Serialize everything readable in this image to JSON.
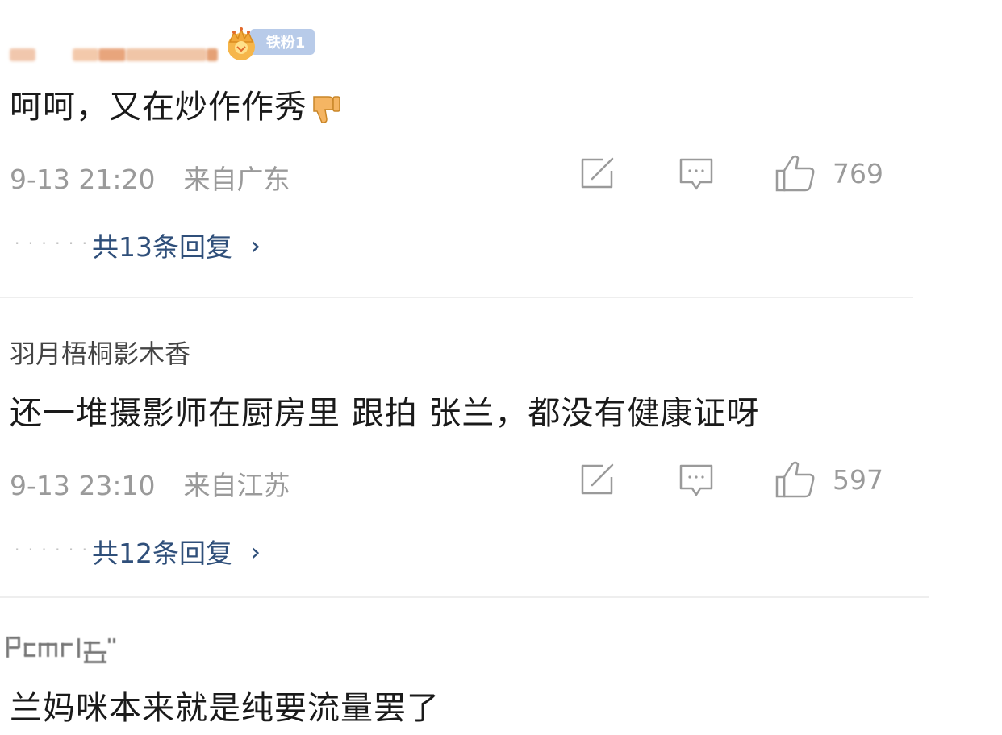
{
  "comments": [
    {
      "username": "",
      "badge": "铁粉1",
      "content": "呵呵，又在炒作作秀",
      "content_emoji": "thumbs-down-icon",
      "time": "9-13 21:20",
      "location": "来自广东",
      "likes": "769",
      "replies": "共13条回复"
    },
    {
      "username": "羽月梧桐影木香",
      "content": "还一堆摄影师在厨房里 跟拍 张兰，都没有健康证呀",
      "time": "9-13 23:10",
      "location": "来自江苏",
      "likes": "597",
      "replies": "共12条回复"
    },
    {
      "username": "",
      "content": "兰妈咪本来就是纯要流量罢了"
    }
  ],
  "reply_dots": "· · · · · ·",
  "reply_arrow": "›",
  "icons": {
    "share": "share-icon",
    "comment": "comment-icon",
    "like": "thumbs-up-icon",
    "badge": "crown-icon"
  },
  "colors": {
    "reply_link": "#2f4f7a",
    "meta_text": "#9a9a9a",
    "badge_bg": "#b8cbe9",
    "crown": "#f2a93b"
  }
}
